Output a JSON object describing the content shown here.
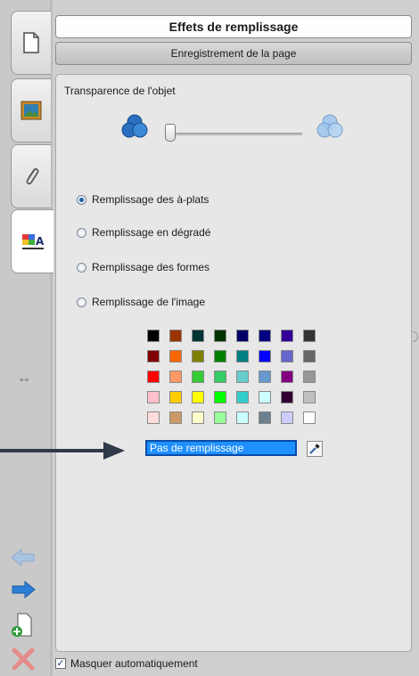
{
  "header": {
    "title": "Effets de remplissage",
    "subtitle_button": "Enregistrement de la page"
  },
  "tabs": [
    {
      "name": "page-sorter",
      "icon": "page-icon"
    },
    {
      "name": "gallery",
      "icon": "picture-icon"
    },
    {
      "name": "attachments",
      "icon": "paperclip-icon"
    },
    {
      "name": "properties",
      "icon": "properties-icon",
      "active": true
    }
  ],
  "transparency": {
    "label": "Transparence de l'objet",
    "level": 0
  },
  "fill_options": [
    {
      "label": "Remplissage des à-plats",
      "checked": true
    },
    {
      "label": "Remplissage en dégradé",
      "checked": false
    },
    {
      "label": "Remplissage des formes",
      "checked": false
    },
    {
      "label": "Remplissage de l'image",
      "checked": false
    }
  ],
  "palette": [
    [
      "#000000",
      "#993300",
      "#003333",
      "#003300",
      "#000066",
      "#000080",
      "#330099",
      "#333333"
    ],
    [
      "#800000",
      "#ff6600",
      "#808000",
      "#008000",
      "#008080",
      "#0000ff",
      "#6666cc",
      "#666666"
    ],
    [
      "#ff0000",
      "#ff9966",
      "#33cc33",
      "#33cc66",
      "#66cccc",
      "#6699cc",
      "#800080",
      "#969696"
    ],
    [
      "#ffc0cb",
      "#ffcc00",
      "#ffff00",
      "#00ff00",
      "#33cccc",
      "#ccffff",
      "#330033",
      "#c0c0c0"
    ],
    [
      "#ffdddd",
      "#cc9966",
      "#ffffcc",
      "#99ff99",
      "#ccffff",
      "#6b7f8e",
      "#ccccff",
      "#ffffff"
    ]
  ],
  "no_fill_label": "Pas de remplissage",
  "auto_hide": {
    "label": "Masquer automatiquement",
    "checked": true
  },
  "colors": {
    "accent": "#1e90ff",
    "callout": "#2f3a4a"
  }
}
